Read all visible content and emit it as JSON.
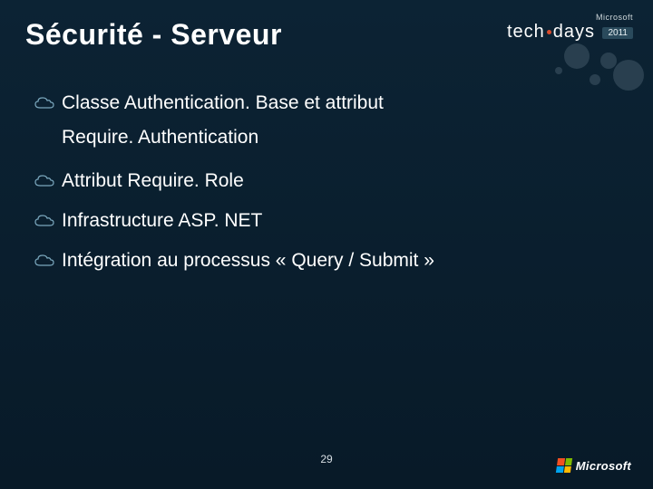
{
  "title": "Sécurité - Serveur",
  "brand": {
    "vendor": "Microsoft",
    "event_prefix": "tech",
    "event_suffix": "days",
    "year": "2011"
  },
  "bullets": [
    {
      "text": "Classe Authentication. Base et attribut",
      "continuation": "Require. Authentication"
    },
    {
      "text": "Attribut Require. Role"
    },
    {
      "text": "Infrastructure ASP. NET"
    },
    {
      "text": "Intégration au processus « Query / Submit »"
    }
  ],
  "page_number": "29",
  "footer_vendor": "Microsoft"
}
